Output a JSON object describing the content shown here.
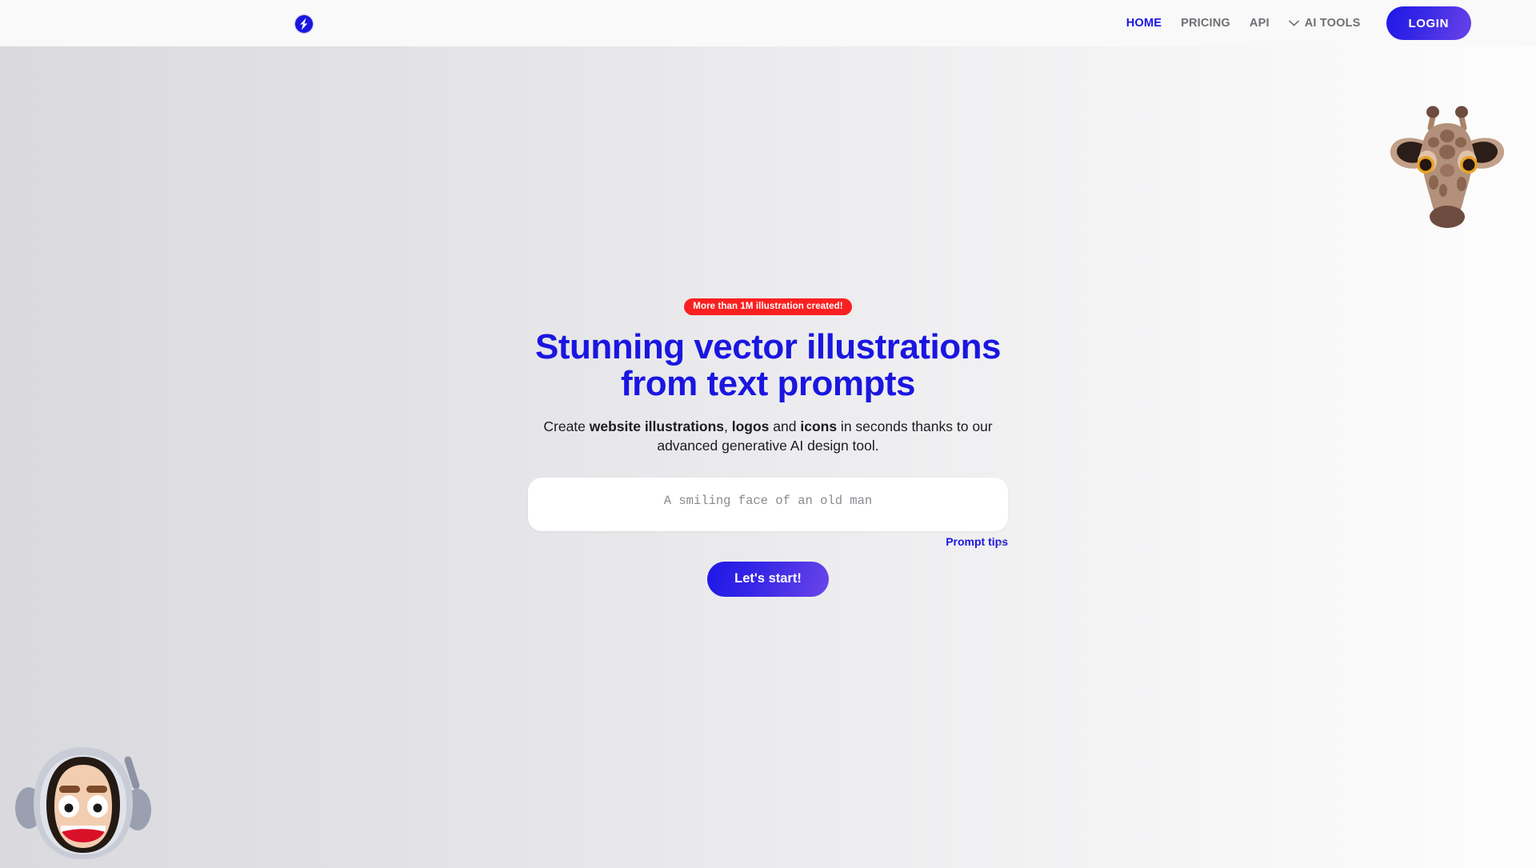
{
  "header": {
    "logo_icon": "lightning-bolt-logo",
    "nav": [
      {
        "label": "HOME",
        "active": true
      },
      {
        "label": "PRICING",
        "active": false
      },
      {
        "label": "API",
        "active": false
      }
    ],
    "ai_tools": {
      "label": "AI TOOLS",
      "icon": "chevron-down-icon"
    },
    "login_label": "LOGIN"
  },
  "hero": {
    "badge": "More than 1M illustration created!",
    "headline": "Stunning vector illustrations from text prompts",
    "subtitle": {
      "part1": "Create ",
      "bold1": "website illustrations",
      "part2": ", ",
      "bold2": "logos",
      "part3": " and ",
      "bold3": "icons",
      "part4": " in seconds thanks to our advanced generative AI design tool."
    },
    "prompt_placeholder": "A smiling face of an old man",
    "prompt_value": "",
    "prompt_tips_label": "Prompt tips",
    "cta_label": "Let's start!"
  },
  "decor": {
    "giraffe": "giraffe-head-illustration",
    "astronaut": "astronaut-face-illustration"
  },
  "colors": {
    "brand_blue": "#1a16e0",
    "badge_red": "#fa2020",
    "nav_grey": "#6e6e73",
    "header_bg": "#f9f9fa"
  }
}
